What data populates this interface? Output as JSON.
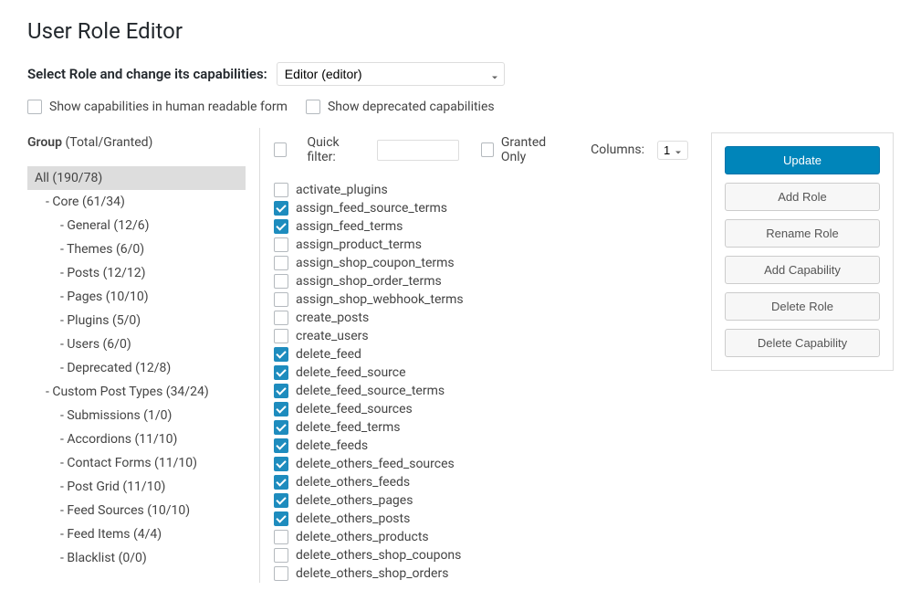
{
  "title": "User Role Editor",
  "select_role_label": "Select Role and change its capabilities:",
  "role_selected": "Editor (editor)",
  "opt_human_readable": "Show capabilities in human readable form",
  "opt_deprecated": "Show deprecated capabilities",
  "group_header_strong": "Group",
  "group_header_rest": " (Total/Granted)",
  "quick_filter_label": "Quick filter:",
  "granted_only_label": "Granted Only",
  "columns_label": "Columns:",
  "columns_value": "1",
  "tree": [
    {
      "label": "All (190/78)",
      "level": 1,
      "selected": true
    },
    {
      "label": "- Core (61/34)",
      "level": 2
    },
    {
      "label": "- General (12/6)",
      "level": 3
    },
    {
      "label": "- Themes (6/0)",
      "level": 3
    },
    {
      "label": "- Posts (12/12)",
      "level": 3
    },
    {
      "label": "- Pages (10/10)",
      "level": 3
    },
    {
      "label": "- Plugins (5/0)",
      "level": 3
    },
    {
      "label": "- Users (6/0)",
      "level": 3
    },
    {
      "label": "- Deprecated (12/8)",
      "level": 3
    },
    {
      "label": "- Custom Post Types (34/24)",
      "level": 2
    },
    {
      "label": "- Submissions (1/0)",
      "level": 3
    },
    {
      "label": "- Accordions (11/10)",
      "level": 3
    },
    {
      "label": "- Contact Forms (11/10)",
      "level": 3
    },
    {
      "label": "- Post Grid (11/10)",
      "level": 3
    },
    {
      "label": "- Feed Sources (10/10)",
      "level": 3
    },
    {
      "label": "- Feed Items (4/4)",
      "level": 3
    },
    {
      "label": "- Blacklist (0/0)",
      "level": 3
    }
  ],
  "caps": [
    {
      "name": "activate_plugins",
      "checked": false
    },
    {
      "name": "assign_feed_source_terms",
      "checked": true
    },
    {
      "name": "assign_feed_terms",
      "checked": true
    },
    {
      "name": "assign_product_terms",
      "checked": false
    },
    {
      "name": "assign_shop_coupon_terms",
      "checked": false
    },
    {
      "name": "assign_shop_order_terms",
      "checked": false
    },
    {
      "name": "assign_shop_webhook_terms",
      "checked": false
    },
    {
      "name": "create_posts",
      "checked": false
    },
    {
      "name": "create_users",
      "checked": false
    },
    {
      "name": "delete_feed",
      "checked": true
    },
    {
      "name": "delete_feed_source",
      "checked": true
    },
    {
      "name": "delete_feed_source_terms",
      "checked": true
    },
    {
      "name": "delete_feed_sources",
      "checked": true
    },
    {
      "name": "delete_feed_terms",
      "checked": true
    },
    {
      "name": "delete_feeds",
      "checked": true
    },
    {
      "name": "delete_others_feed_sources",
      "checked": true
    },
    {
      "name": "delete_others_feeds",
      "checked": true
    },
    {
      "name": "delete_others_pages",
      "checked": true
    },
    {
      "name": "delete_others_posts",
      "checked": true
    },
    {
      "name": "delete_others_products",
      "checked": false
    },
    {
      "name": "delete_others_shop_coupons",
      "checked": false
    },
    {
      "name": "delete_others_shop_orders",
      "checked": false
    }
  ],
  "buttons": {
    "update": "Update",
    "add_role": "Add Role",
    "rename_role": "Rename Role",
    "add_capability": "Add Capability",
    "delete_role": "Delete Role",
    "delete_capability": "Delete Capability"
  }
}
